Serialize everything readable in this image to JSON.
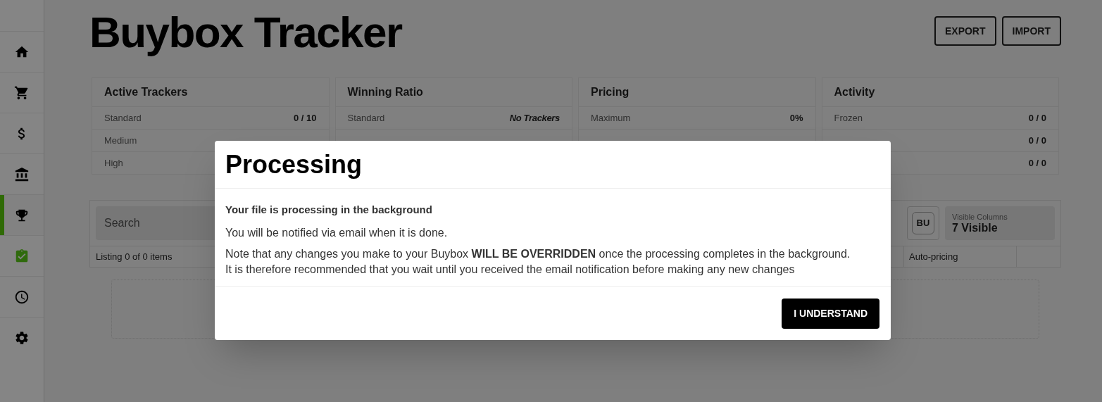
{
  "sidebar": {
    "items": [
      {
        "selected": false,
        "color": "#000000"
      },
      {
        "selected": false,
        "color": "#000000"
      },
      {
        "selected": false,
        "color": "#000000"
      },
      {
        "selected": false,
        "color": "#000000"
      },
      {
        "selected": true,
        "color": "#000000"
      },
      {
        "selected": false,
        "color": "#2f6a0c"
      },
      {
        "selected": false,
        "color": "#000000"
      },
      {
        "selected": false,
        "color": "#000000"
      }
    ]
  },
  "page": {
    "title": "Buybox Tracker",
    "buttons": [
      "EXPORT",
      "IMPORT"
    ]
  },
  "cards": [
    {
      "title": "Active Trackers",
      "rows": [
        {
          "label": "Standard",
          "value": "0 / 10",
          "italic": false
        },
        {
          "label": "Medium"
        },
        {
          "label": "High"
        }
      ]
    },
    {
      "title": "Winning Ratio",
      "rows": [
        {
          "label": "Standard",
          "value": "No Trackers",
          "italic": true
        }
      ]
    },
    {
      "title": "Pricing",
      "rows": [
        {
          "label": "Maximum",
          "value": "0%",
          "italic": false
        }
      ]
    },
    {
      "title": "Activity",
      "rows": [
        {
          "label": "Frozen",
          "value": "0 / 0",
          "italic": false
        },
        {
          "value": "0 / 0",
          "italic": false
        },
        {
          "value": "0 / 0",
          "italic": false
        }
      ]
    }
  ],
  "table": {
    "search": {
      "placeholder": "Search"
    },
    "user_badge": "BU",
    "visible_columns": {
      "label": "Visible Columns",
      "value": "7 Visible"
    },
    "listing": "Listing 0 of 0 items",
    "column": "Auto-pricing"
  },
  "dialog": {
    "title": "Processing",
    "heading": "Your file is processing in the background",
    "paragraphs": [
      "You will be notified via email when it is done.",
      "Note that any changes you make to your Buybox **WILL BE OVERRIDDEN** once the processing completes in the background.",
      "It is therefore recommended that you wait until you received the email notification before making any new changes"
    ],
    "button": "I UNDERSTAND"
  }
}
